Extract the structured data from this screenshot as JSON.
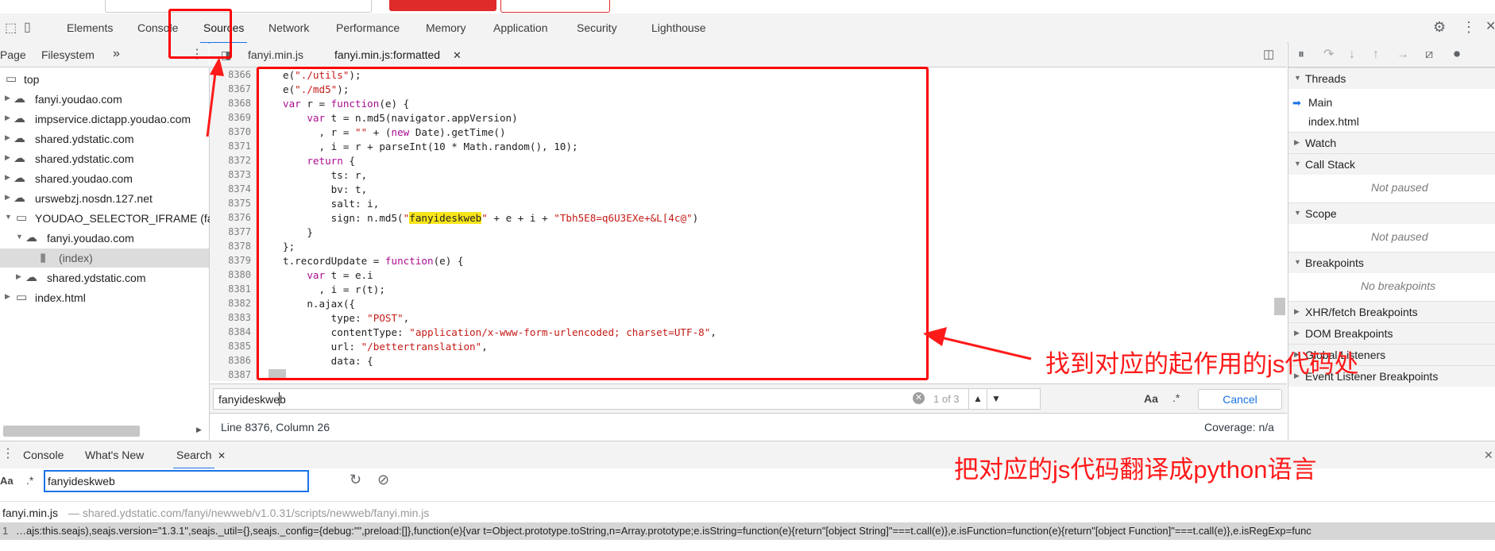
{
  "tabs": [
    "Elements",
    "Console",
    "Sources",
    "Network",
    "Performance",
    "Memory",
    "Application",
    "Security",
    "Lighthouse"
  ],
  "nav": {
    "page_tab": "Page",
    "filesystem_tab": "Filesystem",
    "more": "»"
  },
  "file_tabs": {
    "tab1": "fanyi.min.js",
    "tab2": "fanyi.min.js:formatted"
  },
  "tree": [
    "top",
    "fanyi.youdao.com",
    "impservice.dictapp.youdao.com",
    "shared.ydstatic.com",
    "shared.ydstatic.com",
    "shared.youdao.com",
    "urswebzj.nosdn.127.net",
    "YOUDAO_SELECTOR_IFRAME (fan",
    "fanyi.youdao.com",
    "(index)",
    "shared.ydstatic.com",
    "index.html"
  ],
  "code": {
    "line_numbers": [
      "8366",
      "8367",
      "8368",
      "8369",
      "8370",
      "8371",
      "8372",
      "8373",
      "8374",
      "8375",
      "8376",
      "8377",
      "8378",
      "8379",
      "8380",
      "8381",
      "8382",
      "8383",
      "8384",
      "8385",
      "8386",
      "8387"
    ],
    "lines": [
      [
        "e(",
        [
          "str",
          "\"./utils\""
        ],
        ");"
      ],
      [
        "e(",
        [
          "str",
          "\"./md5\""
        ],
        ");"
      ],
      [
        [
          "kw",
          "var"
        ],
        " r = ",
        [
          "kw",
          "function"
        ],
        "(e) {"
      ],
      [
        "    ",
        [
          "kw",
          "var"
        ],
        " t = n.md5(navigator.appVersion)"
      ],
      [
        "      , r = ",
        [
          "str",
          "\"\""
        ],
        " + (",
        [
          "kw",
          "new"
        ],
        " Date).getTime()"
      ],
      [
        "      , i = r + parseInt(10 * Math.random(), 10);"
      ],
      [
        "    ",
        [
          "kw",
          "return"
        ],
        " {"
      ],
      [
        "        ts: r,"
      ],
      [
        "        bv: t,"
      ],
      [
        "        salt: i,"
      ],
      [
        "        sign: n.md5(",
        [
          "str",
          "\""
        ],
        [
          "hl",
          "fanyideskweb"
        ],
        [
          "str",
          "\""
        ],
        " + e + i + ",
        [
          "str",
          "\"Tbh5E8=q6U3EXe+&L[4c@\""
        ],
        ")"
      ],
      [
        "    }"
      ],
      [
        "};"
      ],
      [
        "t.recordUpdate = ",
        [
          "kw",
          "function"
        ],
        "(e) {"
      ],
      [
        "    ",
        [
          "kw",
          "var"
        ],
        " t = e.i"
      ],
      [
        "      , i = r(t);"
      ],
      [
        "    n.ajax({"
      ],
      [
        "        type: ",
        [
          "str",
          "\"POST\""
        ],
        ","
      ],
      [
        "        contentType: ",
        [
          "str",
          "\"application/x-www-form-urlencoded; charset=UTF-8\""
        ],
        ","
      ],
      [
        "        url: ",
        [
          "str",
          "\"/bettertranslation\""
        ],
        ","
      ],
      [
        "        data: {"
      ],
      [
        ""
      ]
    ]
  },
  "editor_search": {
    "value": "fanyideskweb",
    "count": "1 of 3",
    "match_case": "Aa",
    "regex": ".*",
    "cancel": "Cancel"
  },
  "status": {
    "position": "Line 8376, Column 26",
    "coverage": "Coverage: n/a"
  },
  "debugger": {
    "threads": "Threads",
    "main": "Main",
    "index_html": "index.html",
    "watch": "Watch",
    "call_stack": "Call Stack",
    "not_paused": "Not paused",
    "scope": "Scope",
    "not_paused2": "Not paused",
    "breakpoints": "Breakpoints",
    "no_breakpoints": "No breakpoints",
    "xhr": "XHR/fetch Breakpoints",
    "dom": "DOM Breakpoints",
    "global": "Global Listeners",
    "event": "Event Listener Breakpoints"
  },
  "drawer": {
    "console": "Console",
    "whats_new": "What's New",
    "search": "Search",
    "query": "fanyideskweb",
    "match_case": "Aa",
    "regex": ".*"
  },
  "results": {
    "file": "fanyi.min.js",
    "path": "— shared.ydstatic.com/fanyi/newweb/v1.0.31/scripts/newweb/fanyi.min.js",
    "line_no": "1",
    "snippet": "…ajs:this.seajs),seajs.version=\"1.3.1\",seajs._util={},seajs._config={debug:\"\",preload:[]},function(e){var t=Object.prototype.toString,n=Array.prototype;e.isString=function(e){return\"[object String]\"===t.call(e)},e.isFunction=function(e){return\"[object Function]\"===t.call(e)},e.isRegExp=func"
  },
  "annotations": {
    "find_code": "找到对应的起作用的js代码处",
    "translate": "把对应的js代码翻译成python语言"
  },
  "colors": {
    "accent": "#1a73e8",
    "annotation_red": "#ff0000",
    "highlight": "#f8e51a"
  }
}
